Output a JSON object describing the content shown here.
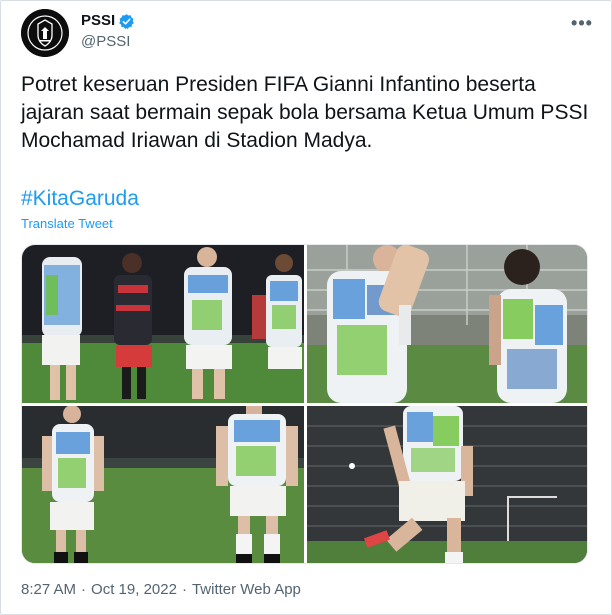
{
  "user": {
    "display_name": "PSSI",
    "handle": "@PSSI",
    "verified": true,
    "avatar_icon": "pssi-logo-icon"
  },
  "tweet": {
    "text": "Potret keseruan Presiden FIFA Gianni Infantino beserta jajaran saat bermain sepak bola bersama Ketua Umum PSSI Mochamad Iriawan di Stadion Madya.",
    "hashtag": "#KitaGaruda",
    "translate_label": "Translate Tweet",
    "time": "8:27 AM",
    "date": "Oct 19, 2022",
    "source": "Twitter Web App",
    "separator": "·"
  },
  "menu": {
    "more_icon": "more-horizontal-icon",
    "more_glyph": "•••"
  },
  "colors": {
    "link": "#1d9bf0",
    "muted": "#536471",
    "text": "#0f1419",
    "verified": "#1d9bf0"
  },
  "media": {
    "photos": [
      {
        "name": "photo-players-celebrating"
      },
      {
        "name": "photo-players-close-up"
      },
      {
        "name": "photo-player-standing-left"
      },
      {
        "name": "photo-player-running"
      }
    ]
  }
}
